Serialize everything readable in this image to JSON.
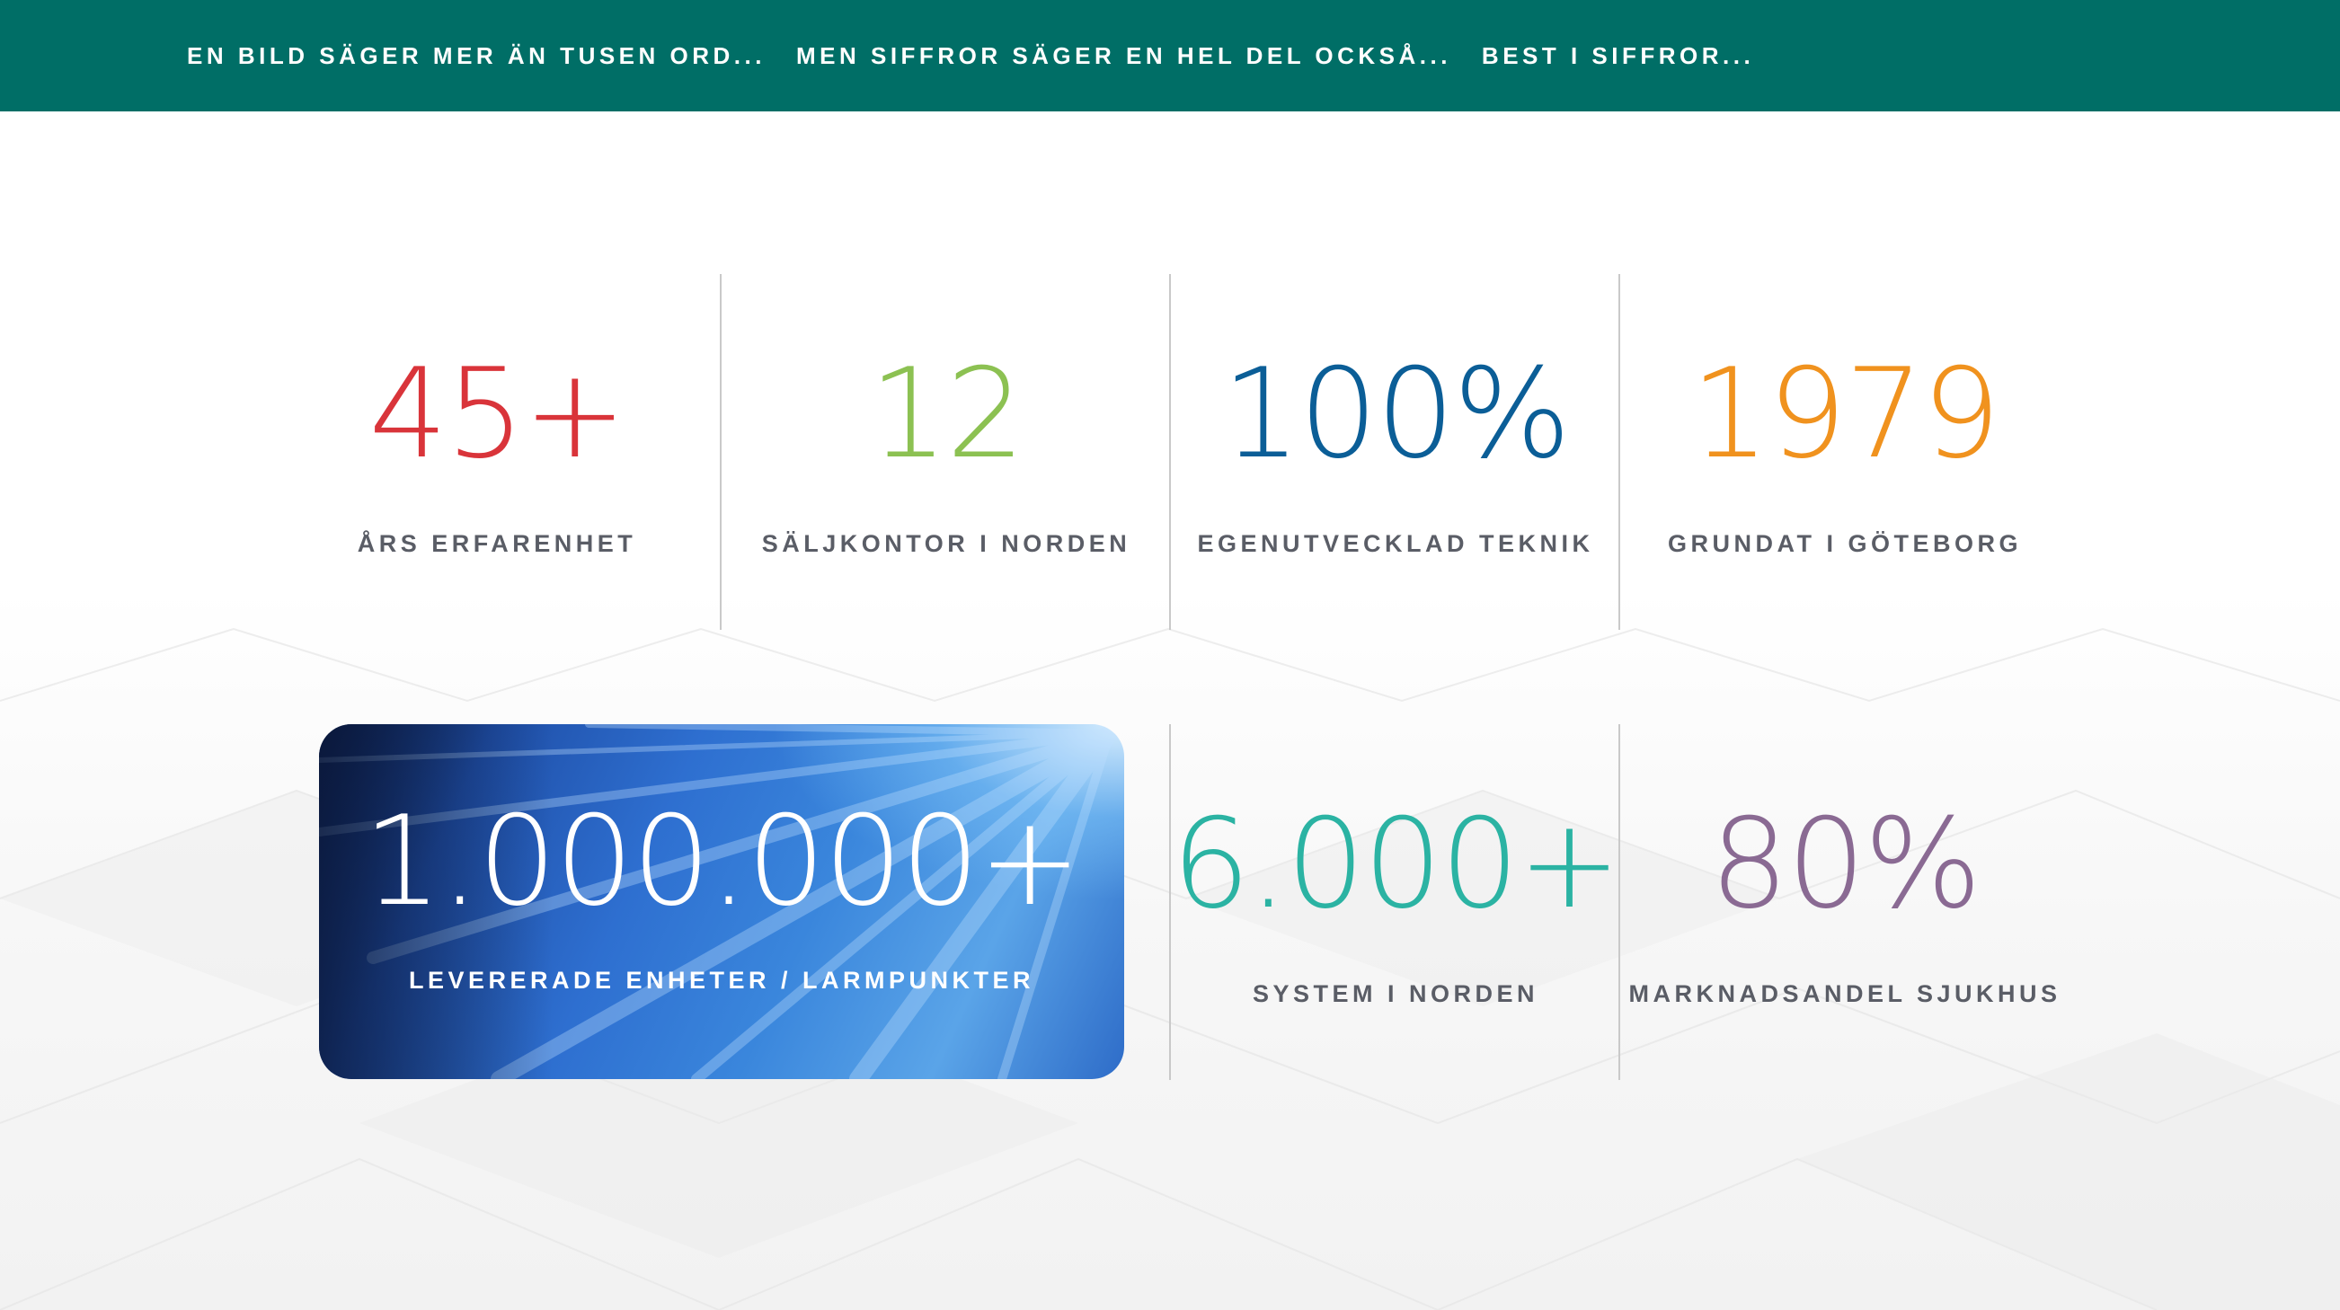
{
  "nav": {
    "items": [
      "EN BILD SÄGER MER ÄN TUSEN ORD...",
      "MEN SIFFROR SÄGER EN HEL DEL OCKSÅ...",
      "BEST I SIFFROR..."
    ]
  },
  "stats_top": [
    {
      "value": "45+",
      "label": "ÅRS ERFARENHET",
      "color": "#d9343a"
    },
    {
      "value": "12",
      "label": "SÄLJKONTOR I NORDEN",
      "color": "#8cc152"
    },
    {
      "value": "100%",
      "label": "EGENUTVECKLAD TEKNIK",
      "color": "#0b5e97"
    },
    {
      "value": "1979",
      "label": "GRUNDAT I GÖTEBORG",
      "color": "#f0921e"
    }
  ],
  "feature": {
    "value": "1.000.000+",
    "label": "LEVERERADE ENHETER / LARMPUNKTER"
  },
  "stats_bottom": [
    {
      "value": "6.000+",
      "label": "SYSTEM I NORDEN",
      "color": "#2bb3a3"
    },
    {
      "value": "80%",
      "label": "MARKNADSANDEL SJUKHUS",
      "color": "#8a6a93"
    }
  ],
  "colors": {
    "topbar": "#006e66",
    "label": "#5a5d66",
    "divider": "#c9c9c9"
  }
}
